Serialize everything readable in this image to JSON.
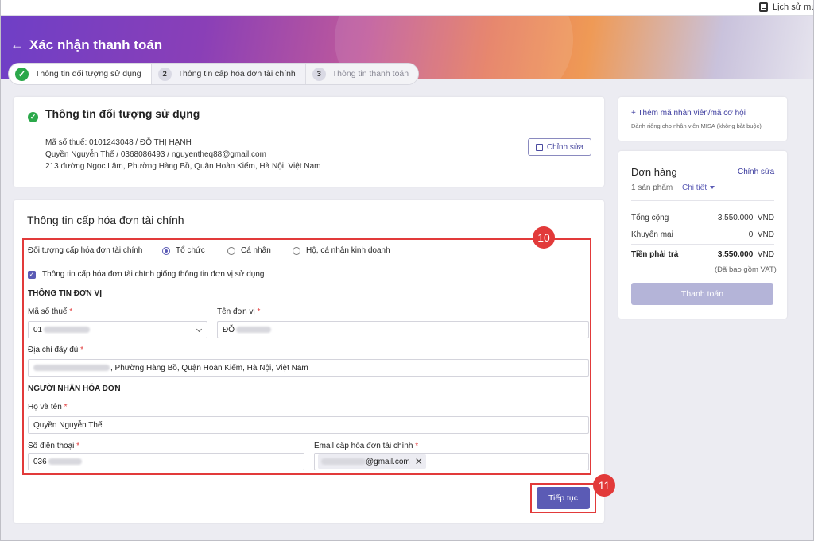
{
  "topbar": {
    "history_label": "Lịch sử mu"
  },
  "header": {
    "title": "Xác nhận thanh toán",
    "back_icon": "←"
  },
  "steps": [
    {
      "label": "Thông tin đối tượng sử dụng",
      "state": "done"
    },
    {
      "number": "2",
      "label": "Thông tin cấp hóa đơn tài chính",
      "state": "active"
    },
    {
      "number": "3",
      "label": "Thông tin thanh toán",
      "state": "pending"
    }
  ],
  "user_card": {
    "title": "Thông tin đối tượng sử dụng",
    "line1": "Mã số thuế: 0101243048 / ĐỖ THỊ HẠNH",
    "line2": "Quyền Nguyễn Thế / 0368086493 / nguyentheq88@gmail.com",
    "line3": "213 đường Ngọc Lâm, Phường Hàng Bồ, Quận Hoàn Kiếm, Hà Nội, Việt Nam",
    "edit_label": "Chỉnh sửa"
  },
  "invoice": {
    "title": "Thông tin cấp hóa đơn tài chính",
    "target_label": "Đối tượng cấp hóa đơn tài chính",
    "radios": [
      "Tổ chức",
      "Cá nhân",
      "Hộ, cá nhân kinh doanh"
    ],
    "selected_radio": "Tổ chức",
    "same_info_label": "Thông tin cấp hóa đơn tài chính giống thông tin đơn vị sử dụng",
    "unit_section": "THÔNG TIN ĐƠN VỊ",
    "tax_label": "Mã số thuế",
    "tax_value": "01",
    "unit_name_label": "Tên đơn vị",
    "unit_name_value": "ĐỖ",
    "address_label": "Địa chỉ đầy đủ",
    "address_value": ", Phường Hàng Bồ, Quận Hoàn Kiếm, Hà Nội, Việt Nam",
    "receiver_section": "NGƯỜI NHẬN HÓA ĐƠN",
    "fullname_label": "Họ và tên",
    "fullname_value": "Quyền Nguyễn Thế",
    "phone_label": "Số điện thoại",
    "phone_value": "036",
    "email_label": "Email cấp hóa đơn tài chính",
    "email_value": "@gmail.com",
    "required_mark": "*",
    "next_label": "Tiếp tục"
  },
  "annotations": {
    "badge_10": "10",
    "badge_11": "11"
  },
  "promo": {
    "link": "+ Thêm mã nhân viên/mã cơ hội",
    "note": "Dành riêng cho nhân viên MISA (không bắt buộc)"
  },
  "order": {
    "title": "Đơn hàng",
    "edit_label": "Chỉnh sửa",
    "count": "1 sản phẩm",
    "detail_label": "Chi tiết",
    "total_label": "Tổng cộng",
    "total_value": "3.550.000",
    "total_unit": "VND",
    "discount_label": "Khuyến mại",
    "discount_value": "0",
    "discount_unit": "VND",
    "pay_label": "Tiền phải trả",
    "pay_value": "3.550.000",
    "pay_unit": "VND",
    "vat_note": "(Đã bao gồm VAT)",
    "pay_button": "Thanh toán"
  },
  "colors": {
    "primary": "#5b5bb5",
    "success": "#2ba84a",
    "highlight": "#e23a3a"
  }
}
